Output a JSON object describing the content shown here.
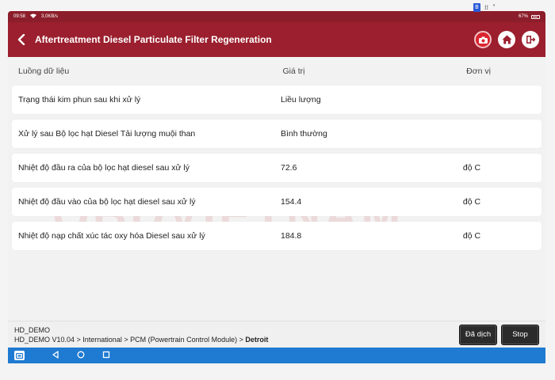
{
  "status_bar": {
    "time": "09:58",
    "signal_text": "3,0KB/s",
    "battery": "67%"
  },
  "overlay": {
    "badge": "B",
    "dots": "⁞⁞",
    "chevron": "˅"
  },
  "title_bar": {
    "title": "Aftertreatment Diesel Particulate Filter Regeneration"
  },
  "table": {
    "headers": [
      "Luồng dữ liệu",
      "Giá trị",
      "Đơn vị"
    ],
    "rows": [
      {
        "name": "Trạng thái kim phun sau khi xử lý",
        "value": "Liều lượng",
        "unit": ""
      },
      {
        "name": "Xử lý sau Bộ lọc hạt Diesel Tải lượng muội than",
        "value": "Bình thường",
        "unit": ""
      },
      {
        "name": "Nhiệt độ đầu ra của bộ lọc hạt diesel sau xử lý",
        "value": "72.6",
        "unit": "độ C"
      },
      {
        "name": "Nhiệt độ đầu vào của bộ lọc hạt diesel sau xử lý",
        "value": "154.4",
        "unit": "độ C"
      },
      {
        "name": "Nhiệt độ nạp chất xúc tác oxy hóa Diesel sau xử lý",
        "value": "184.8",
        "unit": "độ C"
      }
    ]
  },
  "watermark": {
    "line1": "OBDVIETNAM",
    "line2": "CHUYÊN GIA CHẨN ĐOÁN Ô TÔ"
  },
  "footer": {
    "device": "HD_DEMO",
    "path": "HD_DEMO V10.04 > International > PCM (Powertrain Control Module) > ",
    "path_last": "Detroit",
    "translate_label": "Đã dịch",
    "stop_label": "Stop"
  },
  "icons": {
    "back": "chevron-left-icon",
    "camera": "camera-icon",
    "home": "home-icon",
    "exit": "exit-icon"
  },
  "colors": {
    "title_bar": "#9b1f2e",
    "status_bar": "#8c1d2a",
    "nav_bar": "#1f7ad1",
    "camera_button": "#d9242f"
  }
}
